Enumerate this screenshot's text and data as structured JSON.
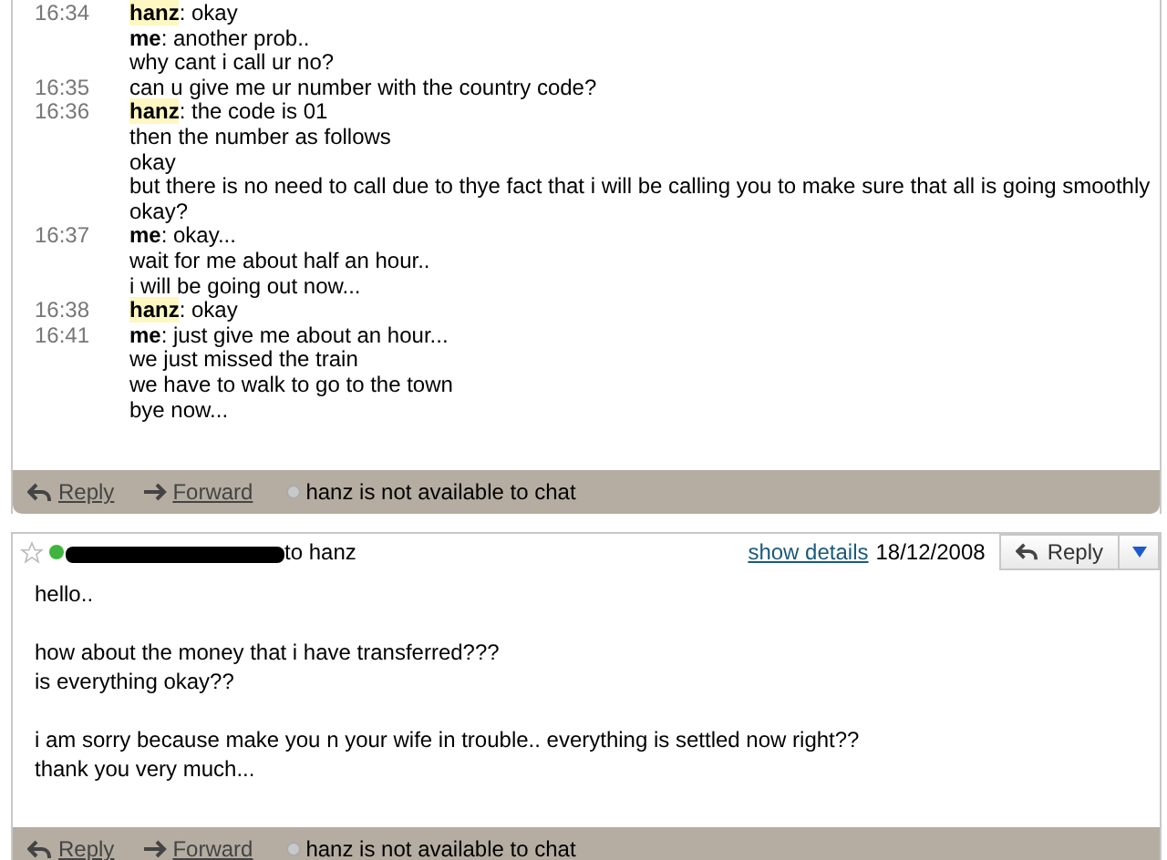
{
  "chat_log": {
    "lines": [
      {
        "time": "16:34",
        "speaker": "hanz",
        "highlighted": true,
        "text": ": okay"
      },
      {
        "speaker": "me",
        "highlighted": false,
        "text": ": another prob.."
      },
      {
        "text": "why cant i call ur no?"
      },
      {
        "time": "16:35",
        "text": "can u give me ur number with the country code?"
      },
      {
        "time": "16:36",
        "speaker": "hanz",
        "highlighted": true,
        "text": ": the code is 01"
      },
      {
        "text": "then the number as follows"
      },
      {
        "text": "okay"
      },
      {
        "text": "but there is no need to call due to thye fact that i will be calling you to make sure that all is going smoothly"
      },
      {
        "text": "okay?"
      },
      {
        "time": "16:37",
        "speaker": "me",
        "highlighted": false,
        "text": ": okay..."
      },
      {
        "text": "wait for me about half an hour.."
      },
      {
        "text": "i will be going out now..."
      },
      {
        "time": "16:38",
        "speaker": "hanz",
        "highlighted": true,
        "text": ": okay"
      },
      {
        "time": "16:41",
        "speaker": "me",
        "highlighted": false,
        "text": ": just give me about an hour..."
      },
      {
        "text": "we just missed the train"
      },
      {
        "text": "we have to walk to go to the town"
      },
      {
        "text": "bye now..."
      }
    ],
    "footer": {
      "reply": "Reply",
      "forward": "Forward",
      "chat_status": "hanz is not available to chat"
    }
  },
  "message": {
    "starred": false,
    "sender_online": true,
    "sender_redacted": true,
    "recipient": "to hanz",
    "show_details": "show details",
    "date": "18/12/2008",
    "reply_button": "Reply",
    "paragraphs": [
      [
        "hello.."
      ],
      [
        "how about the money that i have transferred???",
        "is everything okay??"
      ],
      [
        "i am sorry because make you n your wife in trouble.. everything is settled now right??",
        "thank you very much..."
      ]
    ],
    "footer": {
      "reply": "Reply",
      "forward": "Forward",
      "chat_status": "hanz is not available to chat"
    }
  }
}
